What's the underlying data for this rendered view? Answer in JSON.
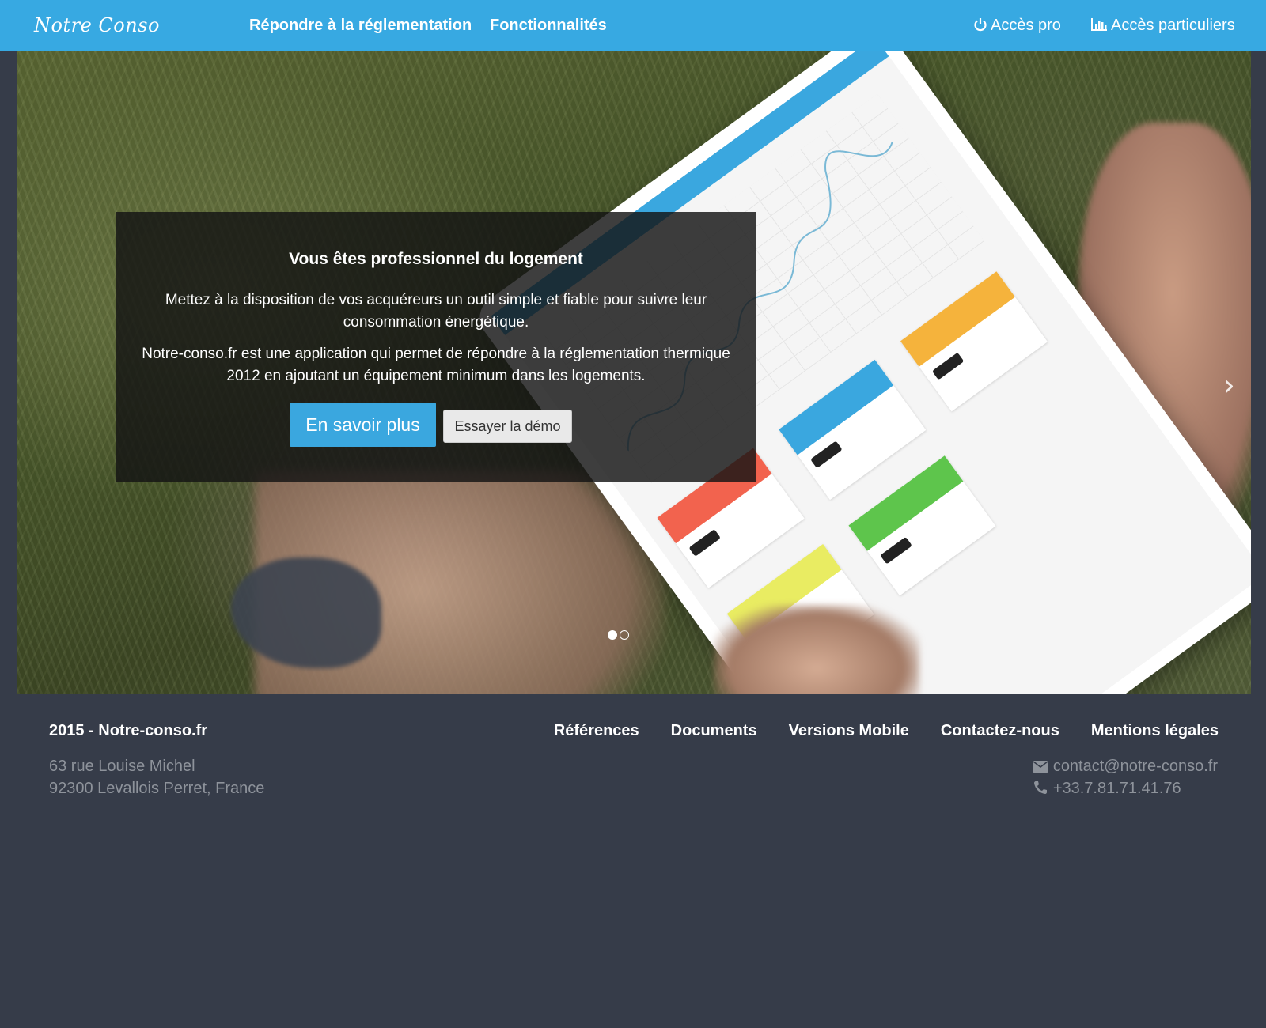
{
  "navbar": {
    "brand": "Notre Conso",
    "links": [
      {
        "label": "Répondre à la réglementation"
      },
      {
        "label": "Fonctionnalités"
      }
    ],
    "right_links": [
      {
        "label": "Accès pro",
        "icon": "power-icon"
      },
      {
        "label": "Accès particuliers",
        "icon": "bar-chart-icon"
      }
    ],
    "color": "#37a9e2"
  },
  "hero": {
    "title": "Vous êtes professionnel du logement",
    "paragraph1": "Mettez à la disposition de vos acquéreurs un outil simple et fiable pour suivre leur consommation énergétique.",
    "paragraph2": "Notre-conso.fr est une application qui permet de répondre à la réglementation thermique 2012 en ajoutant un équipement minimum dans les logements.",
    "primary_button": "En savoir plus",
    "secondary_button": "Essayer la démo",
    "next_arrow": "›",
    "slides_total": 2,
    "active_slide": 1
  },
  "footer": {
    "copyright": "2015 - Notre-conso.fr",
    "links": [
      "Références",
      "Documents",
      "Versions Mobile",
      "Contactez-nous",
      "Mentions légales"
    ],
    "address_line1": "63 rue Louise Michel",
    "address_line2": "92300 Levallois Perret, France",
    "email": "contact@notre-conso.fr",
    "phone": "+33.7.81.71.41.76",
    "background": "#363c49"
  }
}
